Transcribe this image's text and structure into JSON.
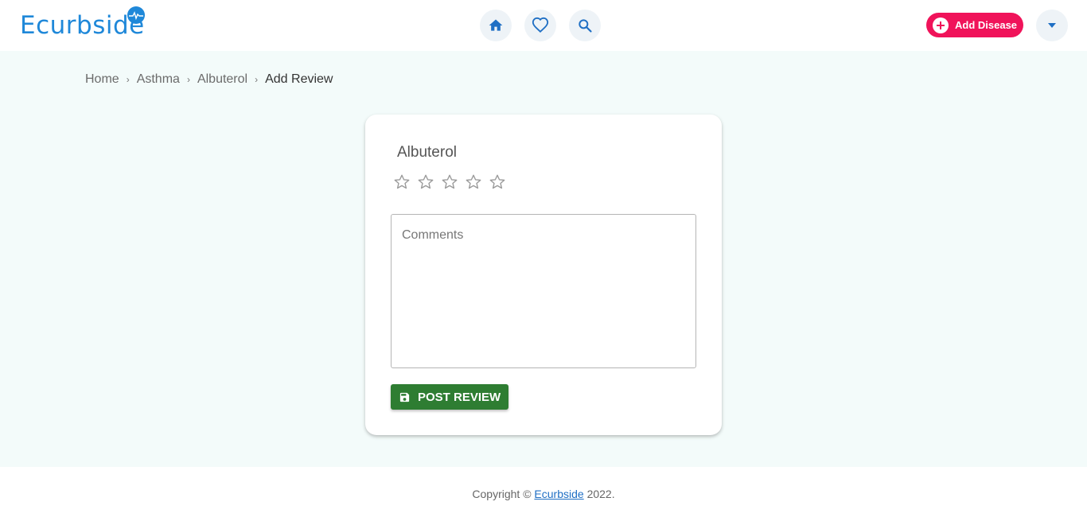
{
  "header": {
    "logo_text": "Ecurbside",
    "add_disease_label": "Add Disease"
  },
  "breadcrumb": {
    "items": [
      "Home",
      "Asthma",
      "Albuterol"
    ],
    "current": "Add Review"
  },
  "review": {
    "drug_name": "Albuterol",
    "rating": 0,
    "rating_max": 5,
    "comments_placeholder": "Comments",
    "comments_value": "",
    "post_label": "POST REVIEW"
  },
  "footer": {
    "prefix": "Copyright ©",
    "link": "Ecurbside",
    "suffix": "2022."
  },
  "colors": {
    "brand": "#1f88d9",
    "accent": "#f0135a",
    "success": "#2e7d32"
  }
}
